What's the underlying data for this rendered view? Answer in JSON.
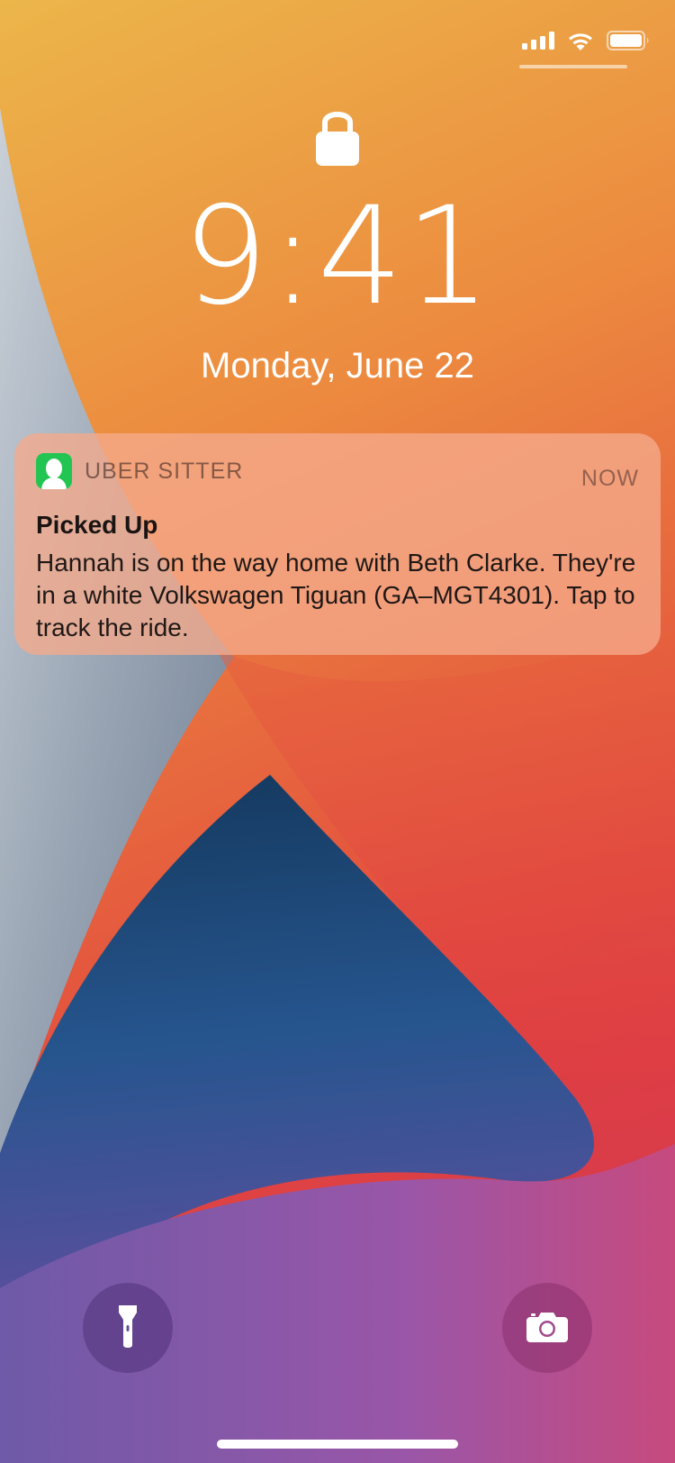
{
  "status_bar": {
    "signal_icon": "signal-icon",
    "wifi_icon": "wifi-icon",
    "battery_icon": "battery-icon"
  },
  "lock_screen": {
    "lock_icon": "lock-icon",
    "time": "9:41",
    "date": "Monday, June 22"
  },
  "notification": {
    "app_icon": "person-icon",
    "app_name": "UBER SITTER",
    "time": "NOW",
    "title": "Picked Up",
    "body": "Hannah is on the way home with Beth Clarke. They're in a white Volkswagen Tiguan (GA–MGT4301). Tap to track the ride."
  },
  "quick_actions": {
    "flashlight_icon": "flashlight-icon",
    "camera_icon": "camera-icon"
  },
  "colors": {
    "app_icon_bg": "#23c552",
    "wallpaper_top": "#ecb24a",
    "wallpaper_red": "#e2403f",
    "wallpaper_blue": "#1d4a7c",
    "wallpaper_purple": "#8a5aa8"
  }
}
